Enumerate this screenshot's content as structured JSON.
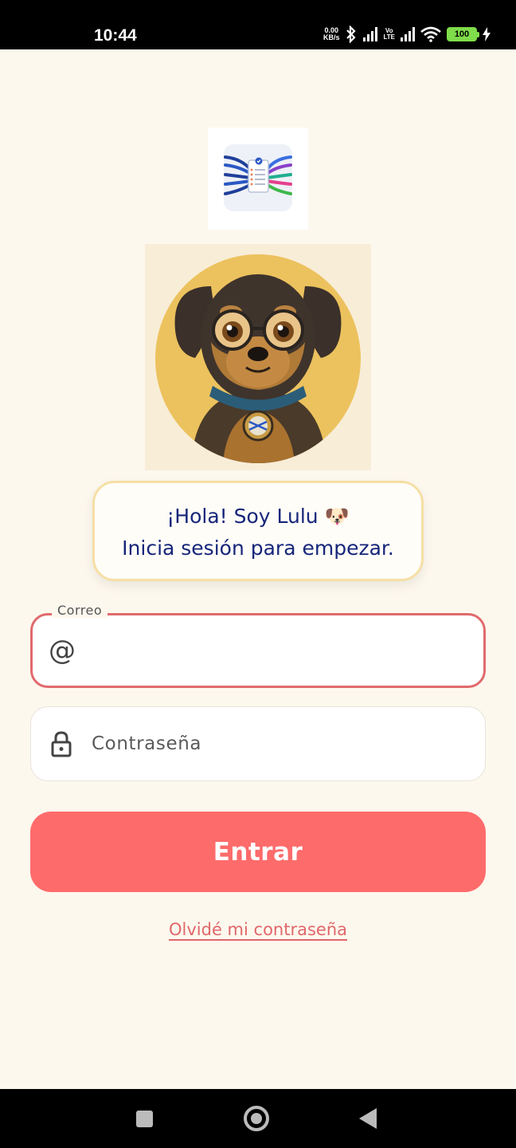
{
  "status_bar": {
    "time": "10:44",
    "net_speed_value": "0.00",
    "net_speed_unit": "KB/s",
    "volte_top": "Vo",
    "volte_bottom": "LTE",
    "battery": "100"
  },
  "greeting": {
    "line1": "¡Hola! Soy Lulu 🐶",
    "line2": "Inicia sesión para empezar."
  },
  "email_field": {
    "label": "Correo",
    "value": "",
    "placeholder": ""
  },
  "password_field": {
    "value": "",
    "placeholder": "Contraseña"
  },
  "login_button": "Entrar",
  "forgot_link": "Olvidé mi contraseña",
  "colors": {
    "background": "#fdf8ee",
    "accent": "#fe6b6b",
    "greeting_text": "#16267a",
    "link": "#e0676a"
  }
}
